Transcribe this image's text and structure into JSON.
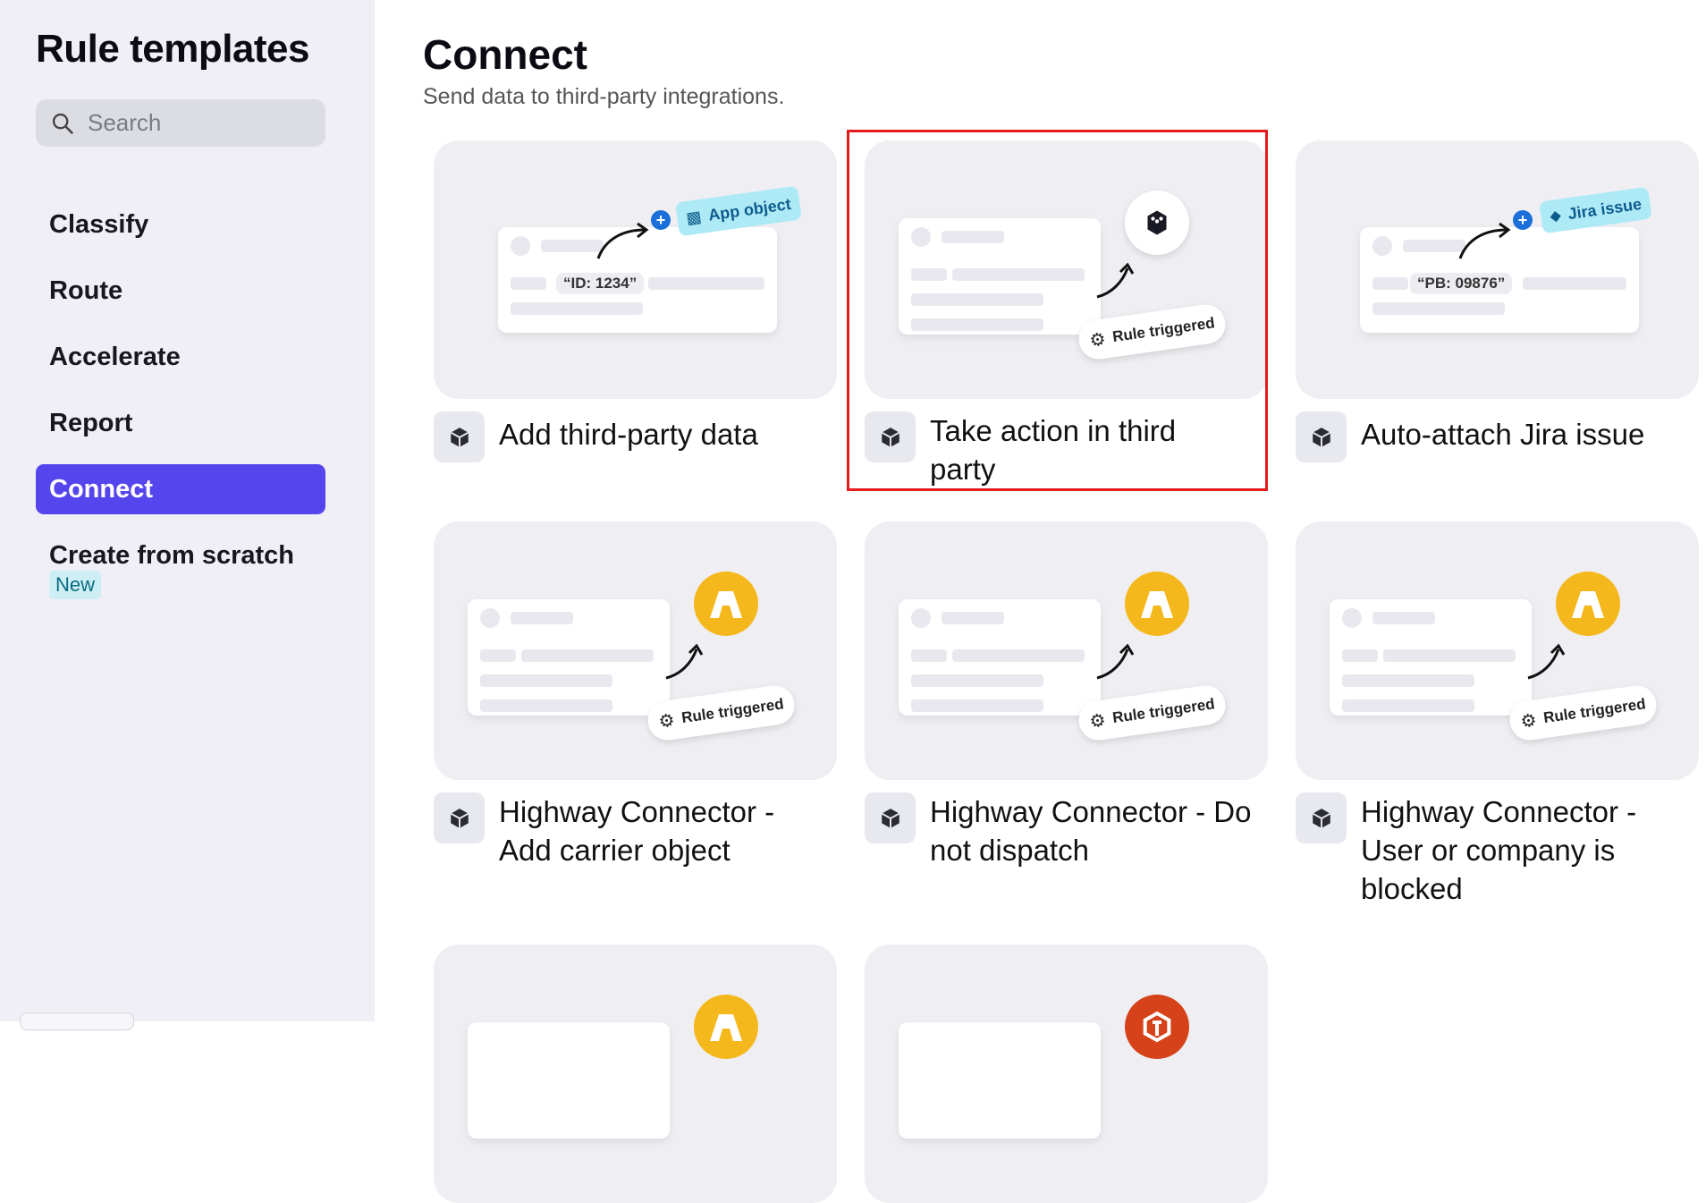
{
  "sidebar": {
    "title": "Rule templates",
    "search_placeholder": "Search",
    "items": [
      {
        "label": "Classify"
      },
      {
        "label": "Route"
      },
      {
        "label": "Accelerate"
      },
      {
        "label": "Report"
      },
      {
        "label": "Connect"
      },
      {
        "label": "Create from scratch"
      }
    ],
    "new_badge": "New",
    "active_item": "Connect"
  },
  "main": {
    "title": "Connect",
    "subtitle": "Send data to third-party integrations.",
    "cards": [
      {
        "title": "Add third-party data",
        "tag": "App object",
        "id_text": "“ID: 1234”"
      },
      {
        "title": "Take action in third party",
        "pill": "Rule triggered"
      },
      {
        "title": "Auto-attach Jira issue",
        "tag": "Jira issue",
        "id_text": "“PB: 09876”"
      },
      {
        "title": "Highway Connector - Add carrier object",
        "pill": "Rule triggered"
      },
      {
        "title": "Highway Connector - Do not dispatch",
        "pill": "Rule triggered"
      },
      {
        "title": "Highway Connector - User or company is blocked",
        "pill": "Rule triggered"
      }
    ]
  },
  "colors": {
    "accent": "#5545ec",
    "highway_yellow": "#f5b81c",
    "highlight_border": "#e31b1b",
    "tag_bg": "#aeeaf6"
  },
  "icons": {
    "search": "search-icon",
    "card_icon": "cube-icon",
    "gear": "gear-icon",
    "plus": "plus-circle-icon",
    "highway": "highway-logo-icon"
  }
}
